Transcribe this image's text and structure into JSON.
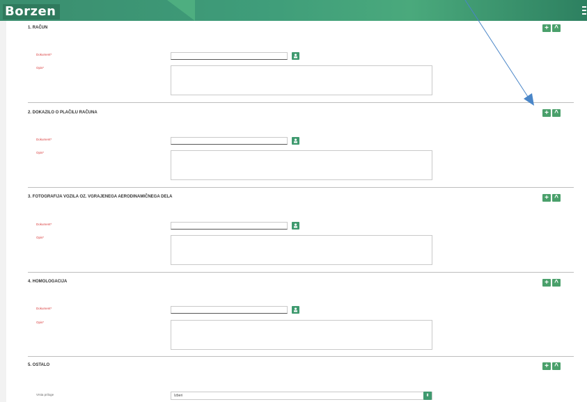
{
  "app": {
    "logo": "Borzen"
  },
  "sections": [
    {
      "title": "1. RAČUN",
      "document_label": "Dokument*",
      "description_label": "Opis*"
    },
    {
      "title": "2. DOKAZILO O PLAČILU RAČUNA",
      "document_label": "Dokument*",
      "description_label": "Opis*"
    },
    {
      "title": "3. FOTOGRAFIJA VOZILA OZ. VGRAJENEGA AERODINAMIČNEGA DELA",
      "document_label": "Dokument*",
      "description_label": "Opis*"
    },
    {
      "title": "4. HOMOLOGACIJA",
      "document_label": "Dokument*",
      "description_label": "Opis*"
    },
    {
      "title": "5. OSTALO",
      "attachment_type_label": "Vrsta priloge",
      "attachment_type_value": "Izberi"
    }
  ],
  "buttons": {
    "add_symbol": "+",
    "collapse_symbol": "^",
    "select_symbol": "⬍"
  },
  "colors": {
    "accent": "#3f9a6f",
    "required_label": "#d93a3a",
    "annotation_arrow": "#4a86c8"
  },
  "icons": {
    "document_picker": "user-icon",
    "menu": "hamburger-icon"
  }
}
